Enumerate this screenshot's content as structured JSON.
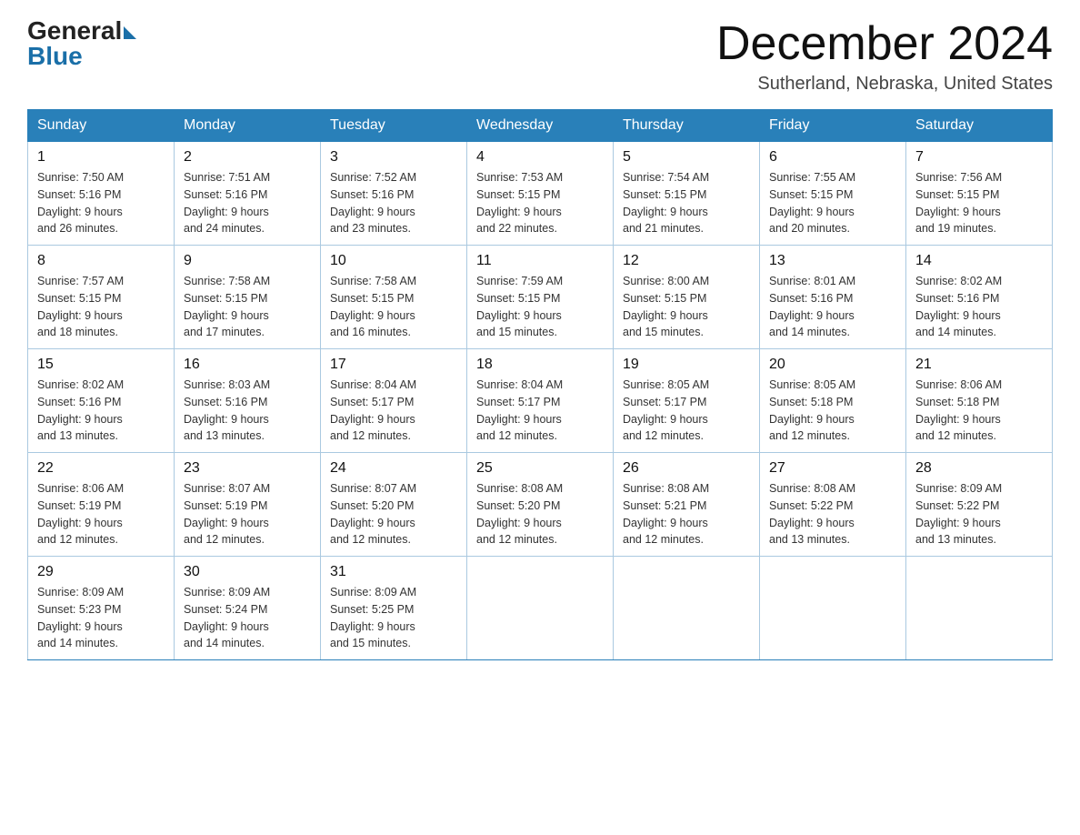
{
  "logo": {
    "general": "General",
    "blue": "Blue"
  },
  "header": {
    "title": "December 2024",
    "location": "Sutherland, Nebraska, United States"
  },
  "days_of_week": [
    "Sunday",
    "Monday",
    "Tuesday",
    "Wednesday",
    "Thursday",
    "Friday",
    "Saturday"
  ],
  "weeks": [
    [
      {
        "day": "1",
        "sunrise": "7:50 AM",
        "sunset": "5:16 PM",
        "daylight": "9 hours and 26 minutes."
      },
      {
        "day": "2",
        "sunrise": "7:51 AM",
        "sunset": "5:16 PM",
        "daylight": "9 hours and 24 minutes."
      },
      {
        "day": "3",
        "sunrise": "7:52 AM",
        "sunset": "5:16 PM",
        "daylight": "9 hours and 23 minutes."
      },
      {
        "day": "4",
        "sunrise": "7:53 AM",
        "sunset": "5:15 PM",
        "daylight": "9 hours and 22 minutes."
      },
      {
        "day": "5",
        "sunrise": "7:54 AM",
        "sunset": "5:15 PM",
        "daylight": "9 hours and 21 minutes."
      },
      {
        "day": "6",
        "sunrise": "7:55 AM",
        "sunset": "5:15 PM",
        "daylight": "9 hours and 20 minutes."
      },
      {
        "day": "7",
        "sunrise": "7:56 AM",
        "sunset": "5:15 PM",
        "daylight": "9 hours and 19 minutes."
      }
    ],
    [
      {
        "day": "8",
        "sunrise": "7:57 AM",
        "sunset": "5:15 PM",
        "daylight": "9 hours and 18 minutes."
      },
      {
        "day": "9",
        "sunrise": "7:58 AM",
        "sunset": "5:15 PM",
        "daylight": "9 hours and 17 minutes."
      },
      {
        "day": "10",
        "sunrise": "7:58 AM",
        "sunset": "5:15 PM",
        "daylight": "9 hours and 16 minutes."
      },
      {
        "day": "11",
        "sunrise": "7:59 AM",
        "sunset": "5:15 PM",
        "daylight": "9 hours and 15 minutes."
      },
      {
        "day": "12",
        "sunrise": "8:00 AM",
        "sunset": "5:15 PM",
        "daylight": "9 hours and 15 minutes."
      },
      {
        "day": "13",
        "sunrise": "8:01 AM",
        "sunset": "5:16 PM",
        "daylight": "9 hours and 14 minutes."
      },
      {
        "day": "14",
        "sunrise": "8:02 AM",
        "sunset": "5:16 PM",
        "daylight": "9 hours and 14 minutes."
      }
    ],
    [
      {
        "day": "15",
        "sunrise": "8:02 AM",
        "sunset": "5:16 PM",
        "daylight": "9 hours and 13 minutes."
      },
      {
        "day": "16",
        "sunrise": "8:03 AM",
        "sunset": "5:16 PM",
        "daylight": "9 hours and 13 minutes."
      },
      {
        "day": "17",
        "sunrise": "8:04 AM",
        "sunset": "5:17 PM",
        "daylight": "9 hours and 12 minutes."
      },
      {
        "day": "18",
        "sunrise": "8:04 AM",
        "sunset": "5:17 PM",
        "daylight": "9 hours and 12 minutes."
      },
      {
        "day": "19",
        "sunrise": "8:05 AM",
        "sunset": "5:17 PM",
        "daylight": "9 hours and 12 minutes."
      },
      {
        "day": "20",
        "sunrise": "8:05 AM",
        "sunset": "5:18 PM",
        "daylight": "9 hours and 12 minutes."
      },
      {
        "day": "21",
        "sunrise": "8:06 AM",
        "sunset": "5:18 PM",
        "daylight": "9 hours and 12 minutes."
      }
    ],
    [
      {
        "day": "22",
        "sunrise": "8:06 AM",
        "sunset": "5:19 PM",
        "daylight": "9 hours and 12 minutes."
      },
      {
        "day": "23",
        "sunrise": "8:07 AM",
        "sunset": "5:19 PM",
        "daylight": "9 hours and 12 minutes."
      },
      {
        "day": "24",
        "sunrise": "8:07 AM",
        "sunset": "5:20 PM",
        "daylight": "9 hours and 12 minutes."
      },
      {
        "day": "25",
        "sunrise": "8:08 AM",
        "sunset": "5:20 PM",
        "daylight": "9 hours and 12 minutes."
      },
      {
        "day": "26",
        "sunrise": "8:08 AM",
        "sunset": "5:21 PM",
        "daylight": "9 hours and 12 minutes."
      },
      {
        "day": "27",
        "sunrise": "8:08 AM",
        "sunset": "5:22 PM",
        "daylight": "9 hours and 13 minutes."
      },
      {
        "day": "28",
        "sunrise": "8:09 AM",
        "sunset": "5:22 PM",
        "daylight": "9 hours and 13 minutes."
      }
    ],
    [
      {
        "day": "29",
        "sunrise": "8:09 AM",
        "sunset": "5:23 PM",
        "daylight": "9 hours and 14 minutes."
      },
      {
        "day": "30",
        "sunrise": "8:09 AM",
        "sunset": "5:24 PM",
        "daylight": "9 hours and 14 minutes."
      },
      {
        "day": "31",
        "sunrise": "8:09 AM",
        "sunset": "5:25 PM",
        "daylight": "9 hours and 15 minutes."
      },
      null,
      null,
      null,
      null
    ]
  ],
  "labels": {
    "sunrise": "Sunrise:",
    "sunset": "Sunset:",
    "daylight": "Daylight:"
  }
}
